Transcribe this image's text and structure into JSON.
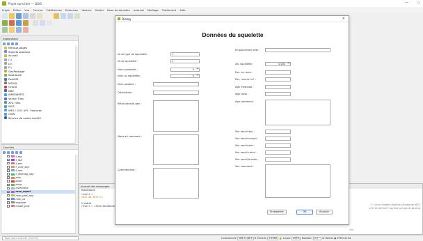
{
  "window": {
    "title": "Projet sans titre — QGIS",
    "minimize": "—",
    "maximize": "▢"
  },
  "menu": [
    "Projet",
    "Éditer",
    "Vue",
    "Couche",
    "Préférences",
    "Extension",
    "Vecteur",
    "Raster",
    "Base de données",
    "Internet",
    "Maillage",
    "Traitement",
    "Aide"
  ],
  "browser": {
    "title": "Explorateur",
    "items": [
      {
        "label": "Marque-pages",
        "color": "#e9b838"
      },
      {
        "label": "Signets spatiaux",
        "color": "#6a8fd6"
      },
      {
        "label": "Accueil",
        "color": "#e1b24a"
      },
      {
        "label": "C:\\",
        "color": "#9aa4ad"
      },
      {
        "label": "D:\\",
        "color": "#9aa4ad"
      },
      {
        "label": "E:\\",
        "color": "#9aa4ad"
      },
      {
        "label": "GeoPackage",
        "color": "#c3a54a"
      },
      {
        "label": "SpatiaLite",
        "color": "#8ab04e"
      },
      {
        "label": "PostGIS",
        "color": "#4a78b4"
      },
      {
        "label": "MSSQL",
        "color": "#7a7a7a"
      },
      {
        "label": "Oracle",
        "color": "#c24a3a"
      },
      {
        "label": "DB2",
        "color": "#3a6aa8"
      },
      {
        "label": "WMS/WMTS",
        "color": "#5a9ad2"
      },
      {
        "label": "Vector Tiles",
        "color": "#6a6ad2"
      },
      {
        "label": "XYZ Tiles",
        "color": "#52a86a"
      },
      {
        "label": "WCS",
        "color": "#5a9ad2"
      },
      {
        "label": "WFS / OGC API - Features",
        "color": "#5a9ad2"
      },
      {
        "label": "OWS",
        "color": "#5a9ad2"
      },
      {
        "label": "Service de cartes ArcGIS",
        "color": "#2a6aa8"
      }
    ]
  },
  "layers": {
    "title": "Couches",
    "items": [
      {
        "label": "t_fag",
        "checked": false,
        "color": "#d66ab0"
      },
      {
        "label": "t_fazi",
        "checked": false,
        "color": "#8a52c8"
      },
      {
        "label": "t_ens",
        "checked": false,
        "color": "#d66ab0"
      },
      {
        "label": "t_cont_sep",
        "checked": false,
        "color": "#d6a052"
      },
      {
        "label": "t_inst",
        "checked": false,
        "color": "#6aa8d6"
      },
      {
        "label": "t_amenag_sep",
        "checked": false,
        "color": "#52b07a"
      },
      {
        "label": "poly",
        "checked": false,
        "color": "#d68a52"
      },
      {
        "label": "point",
        "checked": false,
        "color": "#c04040"
      },
      {
        "label": "ploig",
        "checked": false,
        "color": "#7ab04e"
      },
      {
        "label": "inventaire",
        "checked": false,
        "color": "#b0b0b0"
      },
      {
        "label": "man_squel",
        "checked": true,
        "color": "#a06ad6"
      },
      {
        "label": "man_part_ana",
        "checked": false,
        "color": "#d6b052"
      },
      {
        "label": "man_os",
        "checked": false,
        "color": "#52a0d6"
      },
      {
        "label": "emprise",
        "checked": false,
        "color": "#8a8a8a"
      },
      {
        "label": "coupe_poly",
        "checked": false,
        "color": "#d67a7a"
      }
    ]
  },
  "locator": {
    "placeholder": "Taper pour trouver (Ctrl+K)"
  },
  "status": {
    "coordinate_label": "Coordonnée",
    "coordinate_value": "108.3,-48.3",
    "scale_label": "Échelle",
    "scale_value": "1:1946",
    "magnifier_label": "Loupe",
    "magnifier_value": "100%",
    "rotation_label": "Rotation",
    "rotation_value": "0,0 °",
    "render_label": "Rendu",
    "crs": "EPSG:2154"
  },
  "python": {
    "title": "Journal des messages",
    "tab": "Extensions",
    "lines": [
      "result =",
      "2022-08-30T13:4",
      "",
      "treeWid",
      "result = iface.mainWindow(...)"
    ],
    "right_lines": [
      "C:\\Users\\emmac\\AppData\\Roaming\\QGIS",
      "ofiles\\default\\python\\plugins\\dialog"
    ],
    "prompt": ">>>"
  },
  "dialog": {
    "title": "Dialog",
    "close": "✕",
    "heading": "Données du squelette",
    "left_fields": {
      "id_type_label": "Id du type de squelette :",
      "id_type_value": "1",
      "id_squel_label": "Id du squelette :",
      "id_squel_value": "1",
      "num_squel_label": "Num squelette :",
      "num_squel_value": "0",
      "num_us_label": "Num us squelette :",
      "num_us_value": "0",
      "position_label": "Num position :",
      "orientation_label": "Orientation :",
      "patho_label": "Patho descrip gen :",
      "marq_label": "Marq ad comment :",
      "comment_label": "Commentaire :"
    },
    "right_fields": {
      "emplacement_label": "Emplacement tête :",
      "alt_label": "Alt. squelette :",
      "alt_value": "0,000",
      "pos_bras_label": "Pos. av. bras :",
      "pos_memb_label": "Pos. memb. inf. :",
      "age_methode_label": "Age methode :",
      "age_classe_label": "Age class :",
      "age_comment_label": "Age comment :",
      "sex_dsp_label": "Sex result dsp :",
      "sex_morph_label": "Sex result morph :",
      "sex_adn_label": "Sex result adn :",
      "sex_calcul_label": "Sex result calcul :",
      "sex_bruz_label": "Sex result bruzek :",
      "sex_comment_label": "Sex comment :"
    },
    "buttons": {
      "save": "Enregistrer",
      "ok": "OK",
      "cancel": "Annuler"
    }
  }
}
